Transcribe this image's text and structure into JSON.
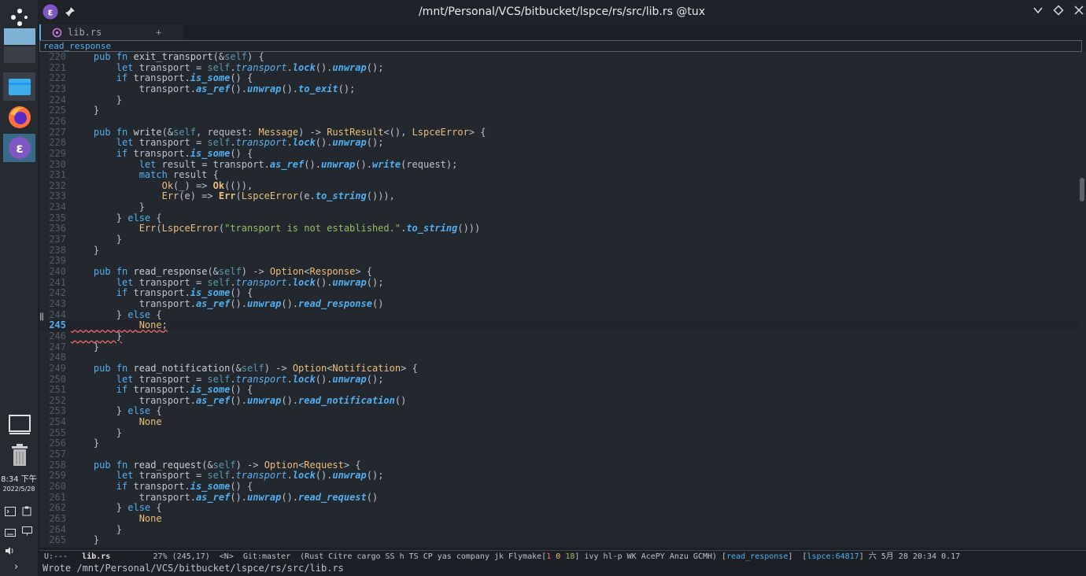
{
  "window": {
    "title": "/mnt/Personal/VCS/bitbucket/lspce/rs/src/lib.rs @tux"
  },
  "tab": {
    "label": "lib.rs",
    "add_label": "+"
  },
  "header_line": "read_response",
  "dock": {
    "clock_time": "8:34 下午",
    "clock_date": "2022/5/28"
  },
  "code": {
    "current_line": 245,
    "lines": [
      {
        "n": "220",
        "t": "    pub fn exit_transport(&self) {"
      },
      {
        "n": "221",
        "t": "        let transport = self.transport.lock().unwrap();"
      },
      {
        "n": "222",
        "t": "        if transport.is_some() {"
      },
      {
        "n": "223",
        "t": "            transport.as_ref().unwrap().to_exit();"
      },
      {
        "n": "224",
        "t": "        }"
      },
      {
        "n": "225",
        "t": "    }"
      },
      {
        "n": "226",
        "t": ""
      },
      {
        "n": "227",
        "t": "    pub fn write(&self, request: Message) -> RustResult<(), LspceError> {"
      },
      {
        "n": "228",
        "t": "        let transport = self.transport.lock().unwrap();"
      },
      {
        "n": "229",
        "t": "        if transport.is_some() {"
      },
      {
        "n": "230",
        "t": "            let result = transport.as_ref().unwrap().write(request);"
      },
      {
        "n": "231",
        "t": "            match result {"
      },
      {
        "n": "232",
        "t": "                Ok(_) => Ok(()),"
      },
      {
        "n": "233",
        "t": "                Err(e) => Err(LspceError(e.to_string())),"
      },
      {
        "n": "234",
        "t": "            }"
      },
      {
        "n": "235",
        "t": "        } else {"
      },
      {
        "n": "236",
        "t": "            Err(LspceError(\"transport is not established.\".to_string()))"
      },
      {
        "n": "237",
        "t": "        }"
      },
      {
        "n": "238",
        "t": "    }"
      },
      {
        "n": "239",
        "t": ""
      },
      {
        "n": "240",
        "t": "    pub fn read_response(&self) -> Option<Response> {"
      },
      {
        "n": "241",
        "t": "        let transport = self.transport.lock().unwrap();"
      },
      {
        "n": "242",
        "t": "        if transport.is_some() {"
      },
      {
        "n": "243",
        "t": "            transport.as_ref().unwrap().read_response()"
      },
      {
        "n": "244",
        "t": "        } else {"
      },
      {
        "n": "245",
        "t": "            None;"
      },
      {
        "n": "246",
        "t": "        }"
      },
      {
        "n": "247",
        "t": "    }"
      },
      {
        "n": "248",
        "t": ""
      },
      {
        "n": "249",
        "t": "    pub fn read_notification(&self) -> Option<Notification> {"
      },
      {
        "n": "250",
        "t": "        let transport = self.transport.lock().unwrap();"
      },
      {
        "n": "251",
        "t": "        if transport.is_some() {"
      },
      {
        "n": "252",
        "t": "            transport.as_ref().unwrap().read_notification()"
      },
      {
        "n": "253",
        "t": "        } else {"
      },
      {
        "n": "254",
        "t": "            None"
      },
      {
        "n": "255",
        "t": "        }"
      },
      {
        "n": "256",
        "t": "    }"
      },
      {
        "n": "257",
        "t": ""
      },
      {
        "n": "258",
        "t": "    pub fn read_request(&self) -> Option<Request> {"
      },
      {
        "n": "259",
        "t": "        let transport = self.transport.lock().unwrap();"
      },
      {
        "n": "260",
        "t": "        if transport.is_some() {"
      },
      {
        "n": "261",
        "t": "            transport.as_ref().unwrap().read_request()"
      },
      {
        "n": "262",
        "t": "        } else {"
      },
      {
        "n": "263",
        "t": "            None"
      },
      {
        "n": "264",
        "t": "        }"
      },
      {
        "n": "265",
        "t": "    }"
      }
    ]
  },
  "modeline": {
    "state": "U:---",
    "buffer": "lib.rs",
    "position": "27% (245,17)",
    "evil": "<N>",
    "vc": "Git:master",
    "modes_prefix": "(Rust Citre cargo SS h TS CP yas company jk Flymake[",
    "flymake_errors": "1",
    "flymake_warnings": "0",
    "flymake_notes": "18",
    "modes_suffix": "] ivy hl-p WK AcePY Anzu GCMH)",
    "which_func": "read_response",
    "lspce": "lspce:64817",
    "datetime": "六 5月 28 20:34 0.17"
  },
  "minibuffer": "Wrote /mnt/Personal/VCS/bitbucket/lspce/rs/src/lib.rs",
  "colors": {
    "accent": "#51afef",
    "keyword": "#51afef",
    "type": "#ecbe7b",
    "string": "#98be65",
    "error": "#ff6c6b",
    "background": "#23272e"
  }
}
